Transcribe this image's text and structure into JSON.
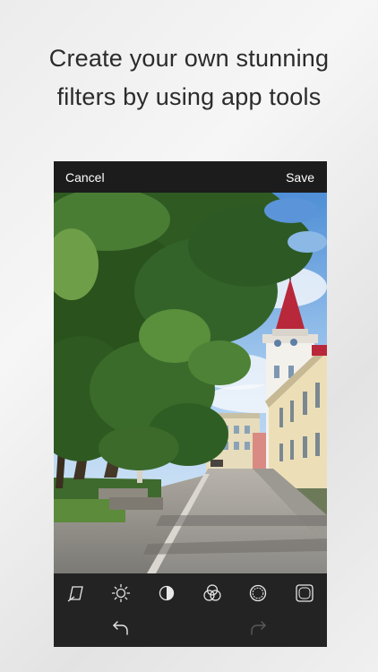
{
  "headline": {
    "line1": "Create your own stunning",
    "line2": "filters by using app tools"
  },
  "editor": {
    "cancel_label": "Cancel",
    "save_label": "Save"
  },
  "tools": [
    {
      "icon": "straighten-icon"
    },
    {
      "icon": "brightness-icon"
    },
    {
      "icon": "contrast-icon"
    },
    {
      "icon": "color-channels-icon"
    },
    {
      "icon": "aperture-icon"
    },
    {
      "icon": "vignette-icon"
    }
  ],
  "history": {
    "undo_icon": "undo-icon",
    "redo_icon": "redo-icon"
  },
  "colors": {
    "bar": "#1c1c1c",
    "toolbar": "#232323",
    "icon": "#e8e8e8",
    "icon_disabled": "#5a5a5a"
  }
}
